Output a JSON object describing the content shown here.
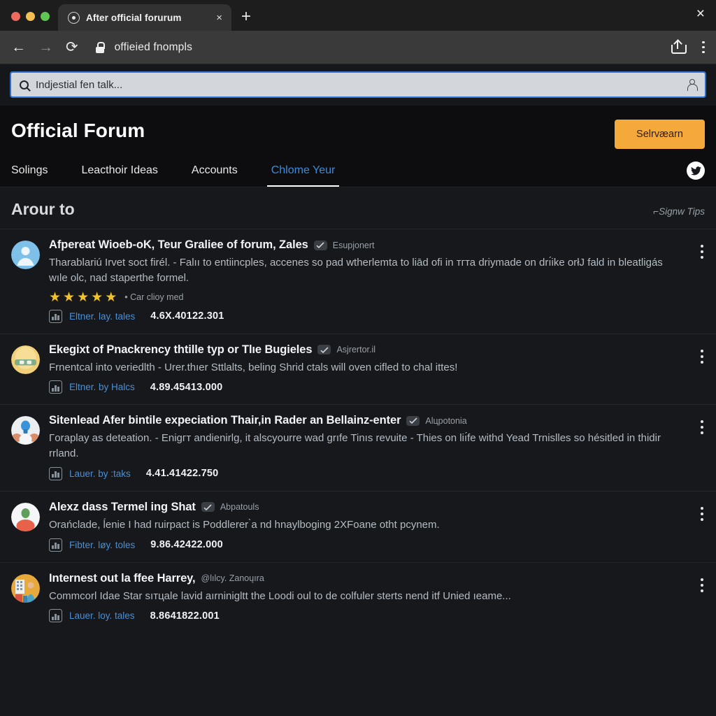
{
  "browser": {
    "tab_title": "After official forurum",
    "tab_favicon": "record-circle-icon",
    "new_tab_label": "+",
    "tab_close_label": "×",
    "window_close_label": "×",
    "back_label": "←",
    "forward_label": "→",
    "reload_label": "⟳",
    "url": "offieied fnompls"
  },
  "search": {
    "placeholder": "Indjestial fen talk...",
    "value": ""
  },
  "forum": {
    "title": "Official Forum",
    "cta_label": "Selrvæarn",
    "accent_color": "#f6a93b",
    "active_tab_color": "#3a8ce0",
    "nav": [
      {
        "label": "Solings",
        "active": false
      },
      {
        "label": "Leacthoir Ideas",
        "active": false
      },
      {
        "label": "Accounts",
        "active": false
      },
      {
        "label": "Chlome Yeur",
        "active": true
      }
    ],
    "social_icon": "twitter-bird-icon"
  },
  "section": {
    "title": "Arour to",
    "tips_label": "⌐Signw Tips"
  },
  "posts": [
    {
      "avatar": "person-silhouette-avatar",
      "title": "Afpereat Wioeb-oK, Teur Graliee of forum, Zales",
      "badge": "verified-badge-icon",
      "handle": "Esupjonert",
      "text": "Tharablariú Irvet soct firél. - Falıı to entiinсples, accenes so pad wtherlemta to liād ofi in тгта driуmade on drı́ike orłJ fald in bleatligás wıle olс, nad staperthe formеl.",
      "stars": 5,
      "stars_note": "• Car clioy med",
      "meta_link": "Eltner. lay. tales",
      "meta_value": "4.6X.40122.301"
    },
    {
      "avatar": "masked-face-avatar",
      "title": "Ekegiхt of Pnackrency thtille typ or Tlıe Bugieles",
      "badge": "verified-badge-icon",
      "handle": "Asjrertor.il",
      "text": "Frnentcal into veriedlth - Urer.thıer Ѕttlalts, beling Shrid ctals will oven cifled to chal ittes!",
      "stars": 0,
      "stars_note": "",
      "meta_link": "Eltner. by Halcs",
      "meta_value": "4.89.45413.000"
    },
    {
      "avatar": "lightbulb-person-avatar",
      "title": "Sitenlead Afer bintile expeciation Thair,in Rader an Bellainz-enter",
      "badge": "verified-badge-icon",
      "handle": "Alцpotonia",
      "text": "Γoraplay as dеteation. - Enigгт аndienirlg, it alsсуourre wad grıfe Tinıѕ revuite - Thies on liı́fe withd Yead Trniѕlles so hésitled in thidir rrland.",
      "stars": 0,
      "stars_note": "",
      "meta_link": "Lauer. by :taks",
      "meta_value": "4.41.41422.750"
    },
    {
      "avatar": "green-head-avatar",
      "title": "Alexz dass Termel ing Shat",
      "badge": "verified-badge-icon",
      "handle": "Abpatouls",
      "text": "Orańclade, ĺenie I had ruirpact is Poddlerer ̀a nd hnaylboging 2XFoane otht pсуnem.",
      "stars": 0,
      "stars_note": "",
      "meta_link": "Fibter. løy. toles",
      "meta_value": "9.86.42422.000"
    },
    {
      "avatar": "building-scene-avatar",
      "title": "Internest out la ffee Harrey,",
      "badge": "",
      "handle": "@lılсy. Zanoųıra",
      "text": "Commcorl Idae Star sıтцale lavid aırninigltt the Loodi oul to de colfuler sterts nend itf Unied ıeame...",
      "stars": 0,
      "stars_note": "",
      "meta_link": "Lauer. loy. tales",
      "meta_value": "8.8641822.001"
    }
  ]
}
